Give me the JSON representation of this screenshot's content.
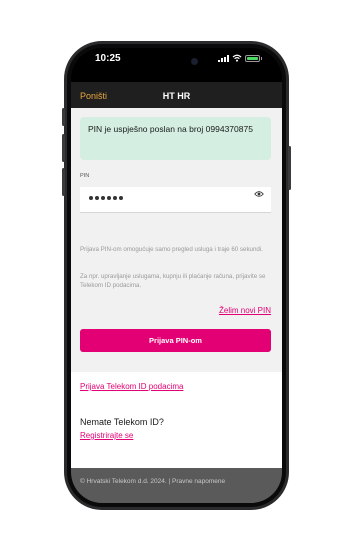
{
  "status_bar": {
    "time": "10:25"
  },
  "nav": {
    "cancel_label": "Poništi",
    "title": "HT HR"
  },
  "alert": {
    "message": "PIN je uspješno poslan na broj 0994370875"
  },
  "pin_form": {
    "label": "PIN",
    "masked_value": "••••••",
    "info_text_1": "Prijava PIN-om omogućuje samo pregled usluga i traje 60 sekundi.",
    "info_text_2": "Za npr. upravljanje uslugama, kupnju ili plaćanje računa, prijavite se Telekom ID podacima.",
    "new_pin_link": "Želim novi PIN",
    "submit_label": "Prijava PIN-om"
  },
  "alternate_login": {
    "telekom_id_link": "Prijava Telekom ID podacima",
    "no_id_label": "Nemate Telekom ID?",
    "register_link": "Registrirajte se"
  },
  "footer": {
    "text": "© Hrvatski Telekom d.d. 2024. | Pravne napomene"
  },
  "colors": {
    "brand_magenta": "#e20074",
    "cancel_orange": "#e8a640",
    "alert_bg": "#d4efe2",
    "nav_bg": "#1f1f1f"
  },
  "icons": {
    "show_pin": "eye-icon",
    "signal": "signal-icon",
    "wifi": "wifi-icon",
    "battery": "battery-icon"
  }
}
